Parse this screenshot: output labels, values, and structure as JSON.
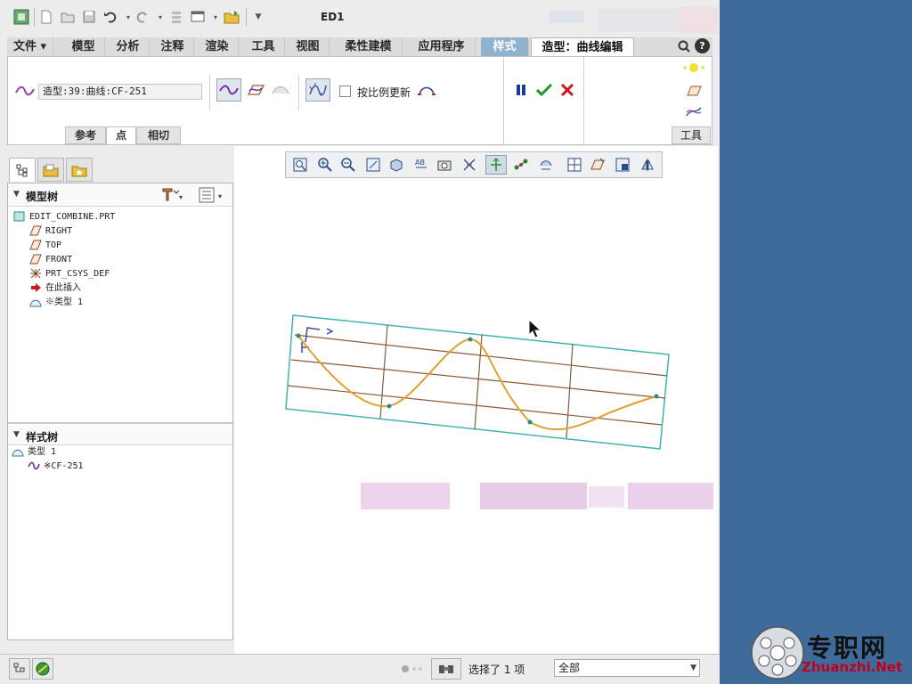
{
  "window": {
    "title": "ED1"
  },
  "quick_access": {
    "icons": [
      "app-icon",
      "new-icon",
      "open-icon",
      "save-icon",
      "undo-icon",
      "redo-icon",
      "regenerate-icon",
      "window-icon",
      "folder-icon",
      "customize-icon"
    ]
  },
  "ribbon_tabs": [
    {
      "label": "文件",
      "has_dropdown": true
    },
    {
      "label": "模型"
    },
    {
      "label": "分析"
    },
    {
      "label": "注释"
    },
    {
      "label": "渲染"
    },
    {
      "label": "工具"
    },
    {
      "label": "视图"
    },
    {
      "label": "柔性建模"
    },
    {
      "label": "应用程序"
    },
    {
      "label": "样式",
      "highlight": true
    },
    {
      "label": "造型：曲线编辑",
      "active": true
    }
  ],
  "ribbon": {
    "curve_field_value": "造型:39:曲线:CF-251",
    "scale_update_label": "按比例更新",
    "scale_update_checked": false,
    "subtabs": [
      "参考",
      "点",
      "相切"
    ],
    "active_subtab": "点",
    "tools_label": "工具",
    "pause_label": "pause",
    "ok_label": "ok",
    "cancel_label": "cancel"
  },
  "left_panel": {
    "model_tree_title": "模型树",
    "model_tree": [
      {
        "label": "EDIT_COMBINE.PRT",
        "icon": "part-icon",
        "level": 0
      },
      {
        "label": "RIGHT",
        "icon": "datum-plane-icon",
        "level": 1
      },
      {
        "label": "TOP",
        "icon": "datum-plane-icon",
        "level": 1
      },
      {
        "label": "FRONT",
        "icon": "datum-plane-icon",
        "level": 1
      },
      {
        "label": "PRT_CSYS_DEF",
        "icon": "csys-icon",
        "level": 1
      },
      {
        "label": "在此插入",
        "icon": "insert-arrow-icon",
        "level": 1
      },
      {
        "label": "※类型 1",
        "icon": "style-feature-icon",
        "level": 1
      }
    ],
    "style_tree_title": "样式树",
    "style_tree": [
      {
        "label": "类型 1",
        "icon": "style-feature-icon",
        "level": 0
      },
      {
        "label": "※CF-251",
        "icon": "curve-icon",
        "level": 1
      }
    ]
  },
  "graphics_toolbar": {
    "icons": [
      "refit-icon",
      "zoom-in-icon",
      "zoom-out-icon",
      "repaint-icon",
      "display-style-icon",
      "saved-views-icon",
      "view-manager-icon",
      "perspective-icon",
      "datum-display-icon",
      "spin-center-icon",
      "point-display-icon",
      "annotation-display-icon",
      "grid-icon",
      "plane-icon",
      "orient-icon",
      "flip-icon"
    ]
  },
  "status_bar": {
    "selection_text": "选择了 1 项",
    "filter_value": "全部"
  },
  "watermark": {
    "chinese": "专职网",
    "english": "Zhuanzhi.Net"
  },
  "colors": {
    "accent_tab": "#8fb3cf",
    "curve": "#e0a030",
    "frame": "#40b4b0",
    "grid": "#8a5a3a",
    "ok_green": "#1a9a2a",
    "cancel_red": "#cc1a1a",
    "pause_blue": "#1c3a9a"
  }
}
